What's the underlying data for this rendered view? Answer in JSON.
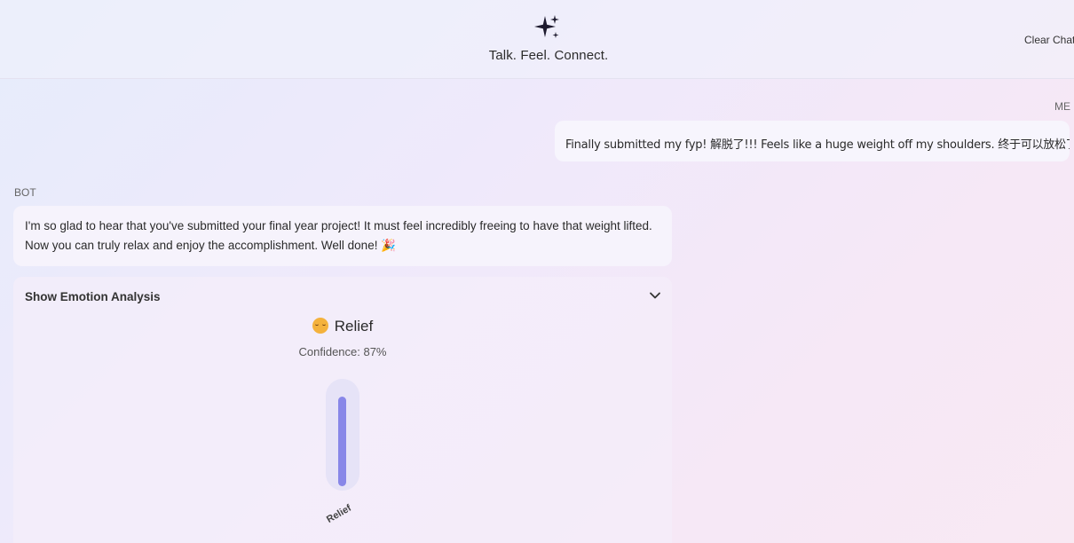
{
  "header": {
    "tagline": "Talk. Feel. Connect.",
    "logo_icon": "sparkles-icon",
    "clear_label": "Clear Chat"
  },
  "messages": {
    "me": {
      "sender": "ME",
      "text": "Finally submitted my fyp! 解脱了!!! Feels like a huge weight off my shoulders. 终于可以放松了"
    },
    "bot": {
      "sender": "BOT",
      "text": "I'm so glad to hear that you've submitted your final year project! It must feel incredibly freeing to have that weight lifted. Now you can truly relax and enjoy the accomplishment. Well done! 🎉"
    }
  },
  "emotion_analysis": {
    "toggle_label": "Show Emotion Analysis",
    "emotion": "Relief",
    "emoji": "relieved-face-icon",
    "confidence_text": "Confidence: 87%",
    "confidence_value": 0.87,
    "bar_label": "Relief",
    "bar_color": "#8887e8"
  },
  "colors": {
    "accent": "#8887e8",
    "bubble": "#f6f3fc"
  }
}
